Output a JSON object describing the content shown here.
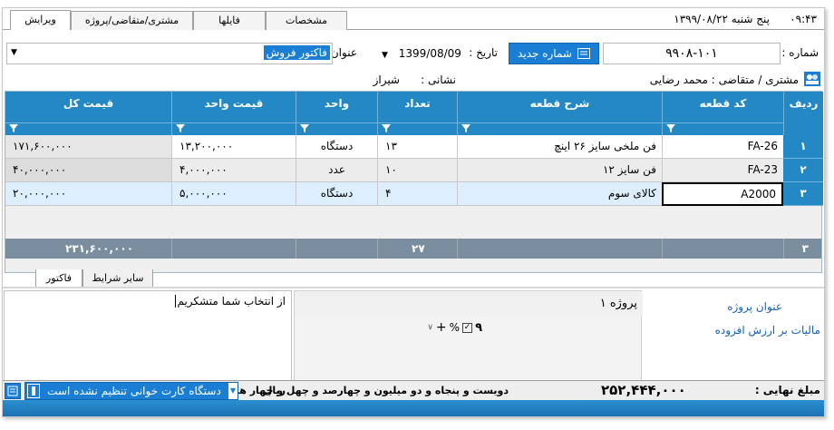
{
  "topbar": {
    "time": "۰۹:۴۳",
    "day_date": "پنج شنبه  ۱۳۹۹/۰۸/۲۲",
    "tabs": [
      "مشخصات",
      "فایلها",
      "مشتری/متقاضی/پروژه",
      "ویرایش"
    ]
  },
  "header": {
    "number_label": "شماره :",
    "number_value": "۹۹۰۸-۱۰۱",
    "new_number_button": "شماره جدید",
    "date_label": "تاریخ :",
    "date_value": "1399/08/09",
    "title_label": "عنوان :",
    "title_value": "فاکتور فروش",
    "customer_label": "مشتری / متقاضی :",
    "customer_value": "محمد رضایی",
    "address_label": "نشانی :",
    "address_value": "شیراز"
  },
  "grid": {
    "columns": {
      "row": "ردیف",
      "code": "کد قطعه",
      "desc": "شرح قطعه",
      "qty": "تعداد",
      "unit": "واحد",
      "unit_price": "قیمت واحد",
      "total": "قیمت کل"
    },
    "rows": [
      {
        "n": "۱",
        "code": "FA-26",
        "desc": "فن ملخی سایز ۲۶ اینچ",
        "qty": "۱۳",
        "unit": "دستگاه",
        "unit_price": "۱۳,۲۰۰,۰۰۰",
        "total": "۱۷۱,۶۰۰,۰۰۰"
      },
      {
        "n": "۲",
        "code": "FA-23",
        "desc": "فن سایز ۱۲",
        "qty": "۱۰",
        "unit": "عدد",
        "unit_price": "۴,۰۰۰,۰۰۰",
        "total": "۴۰,۰۰۰,۰۰۰"
      },
      {
        "n": "۳",
        "code": "A2000",
        "desc": "کالای سوم",
        "qty": "۴",
        "unit": "دستگاه",
        "unit_price": "۵,۰۰۰,۰۰۰",
        "total": "۲۰,۰۰۰,۰۰۰"
      }
    ],
    "footer": {
      "count": "۳",
      "qty_sum": "۲۷",
      "total_sum": "۲۳۱,۶۰۰,۰۰۰"
    }
  },
  "subtabs": [
    "سایر شرایط",
    "فاکتور"
  ],
  "lower": {
    "note_text": "از انتخاب شما متشکریم",
    "project_title_label": "عنوان پروژه",
    "project_title_value": "پروژه ۱",
    "vat_label": "مالیات بر ارزش افزوده",
    "vat_value": "۹",
    "vat_percent": "%",
    "vat_plus": "+"
  },
  "status": {
    "final_label": "مبلغ نهایی :",
    "final_value": "۲۵۲,۴۴۴,۰۰۰",
    "amount_words": "دویست و پنجاه و دو میلیون و چهارصد و چهل و چهار هزار",
    "currency": "ریال",
    "card_reader": "دستگاه کارت خوانی تنظیم نشده است"
  },
  "colors": {
    "accent": "#1a7fd4",
    "header_blue": "#2388c4",
    "footer_gray": "#7a8ea0"
  }
}
